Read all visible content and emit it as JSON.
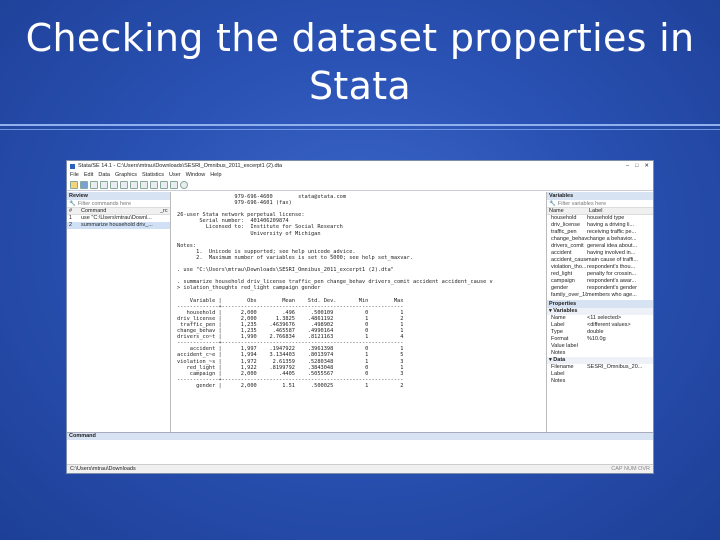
{
  "slide": {
    "title_line1": "Checking the dataset properties in",
    "title_line2": "Stata"
  },
  "window": {
    "title": "Stata/SE 14.1 - C:\\Users\\mtrau\\Downloads\\SESRI_Omnibus_2011_excerpt1 (2).dta",
    "menu": [
      "File",
      "Edit",
      "Data",
      "Graphics",
      "Statistics",
      "User",
      "Window",
      "Help"
    ]
  },
  "review": {
    "header": "Review",
    "filter_placeholder": "Filter commands here",
    "col_num": "#",
    "col_command": "Command",
    "col_rc": "_rc",
    "rows": [
      {
        "n": "1",
        "cmd": "use \"C:\\Users\\mtrau\\Downl..."
      },
      {
        "n": "2",
        "cmd": "summarize household driv_..."
      }
    ]
  },
  "results": {
    "lines": [
      "                  979-696-4600        stata@stata.com",
      "                  979-696-4601 (fax)",
      "",
      "26-user Stata network perpetual license:",
      "       Serial number:  401406209874",
      "         Licensed to:  Institute for Social Research",
      "                       University of Michigan",
      "",
      "Notes:",
      "      1.  Unicode is supported; see help unicode_advice.",
      "      2.  Maximum number of variables is set to 5000; see help set_maxvar.",
      "",
      ". use \"C:\\Users\\mtrau\\Downloads\\SESRI_Omnibus_2011_excerpt1 (2).dta\"",
      "",
      ". summarize household driv_license traffic_pen change_behav drivers_comit accident accident_cause v",
      "> iolation_thoughts red_light campaign gender",
      "",
      "    Variable |        Obs        Mean    Std. Dev.       Min        Max",
      "-------------+---------------------------------------------------------",
      "   household |      2,000        .496     .500109          0          1",
      "driv_license |      2,000      1.3825    .4861192          1          2",
      " traffic_pen |      1,235    .4639676     .498902          0          1",
      "change_behav |      1,235     .465587    .4990164          0          1",
      "drivers_co~t |      1,990    2.766834    .8121163          1          4",
      "-------------+---------------------------------------------------------",
      "    accident |      1,997    .1947922    .3961398          0          1",
      "accident_c~e |      1,994    3.134403    .8013974          1          5",
      "violation_~s |      1,972     2.61359    .5280348          1          3",
      "   red_light |      1,922    .8199792    .3843048          0          1",
      "    campaign |      2,000       .4405    .5055567          0          3",
      "-------------+---------------------------------------------------------",
      "      gender |      2,000        1.51     .500025          1          2"
    ]
  },
  "variables": {
    "header": "Variables",
    "filter_placeholder": "Filter variables here",
    "col_name": "Name",
    "col_label": "Label",
    "rows": [
      {
        "name": "household",
        "label": "household type"
      },
      {
        "name": "driv_license",
        "label": "having a driving li..."
      },
      {
        "name": "traffic_pen",
        "label": "receiving traffic pe..."
      },
      {
        "name": "change_behav",
        "label": "change a behavior..."
      },
      {
        "name": "drivers_comit",
        "label": "general idea about..."
      },
      {
        "name": "accident",
        "label": "having involved in..."
      },
      {
        "name": "accident_cause",
        "label": "main cause of traffi..."
      },
      {
        "name": "violation_tho...",
        "label": "respondent's thou..."
      },
      {
        "name": "red_light",
        "label": "penalty for crossin..."
      },
      {
        "name": "campaign",
        "label": "respondent's awar..."
      },
      {
        "name": "gender",
        "label": "respondent's gender"
      },
      {
        "name": "family_over_18",
        "label": "members who age..."
      }
    ]
  },
  "properties": {
    "header": "Properties",
    "vars_group": "Variables",
    "var_rows": [
      {
        "k": "Name",
        "v": "<11 selected>"
      },
      {
        "k": "Label",
        "v": "<different values>"
      },
      {
        "k": "Type",
        "v": "double"
      },
      {
        "k": "Format",
        "v": "%10.0g"
      },
      {
        "k": "Value label",
        "v": ""
      },
      {
        "k": "Notes",
        "v": ""
      }
    ],
    "data_group": "Data",
    "data_rows": [
      {
        "k": "Filename",
        "v": "SESRI_Omnibus_20..."
      },
      {
        "k": "Label",
        "v": ""
      },
      {
        "k": "Notes",
        "v": ""
      }
    ]
  },
  "command": {
    "header": "Command"
  },
  "status": {
    "path": "C:\\Users\\mtrau\\Downloads",
    "indicators": "CAP  NUM  OVR"
  }
}
